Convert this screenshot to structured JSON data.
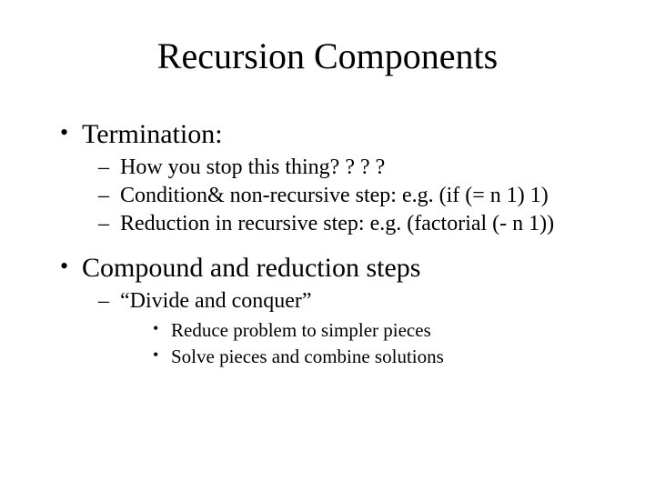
{
  "title": "Recursion Components",
  "bullets": [
    {
      "text": "Termination:",
      "sub": [
        {
          "text": "How you stop this thing? ? ? ?"
        },
        {
          "text": "Condition& non-recursive step: e.g. (if (= n 1) 1)"
        },
        {
          "text": "Reduction in recursive step: e.g. (factorial (- n 1))"
        }
      ]
    },
    {
      "text": "Compound and reduction steps",
      "sub": [
        {
          "text": "“Divide and conquer”",
          "sub": [
            {
              "text": "Reduce problem to simpler pieces"
            },
            {
              "text": "Solve pieces and combine solutions"
            }
          ]
        }
      ]
    }
  ]
}
